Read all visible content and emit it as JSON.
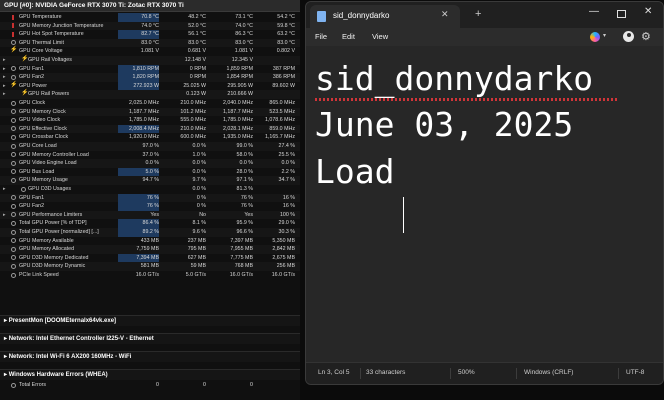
{
  "hwinfo": {
    "gpu_group": "GPU [#0]: NVIDIA GeForce RTX 3070 Ti: Zotac RTX 3070 Ti",
    "rows": [
      {
        "label": "GPU Temperature",
        "icon": "temperature-icon",
        "v": [
          "70.8 °C",
          "48.2 °C",
          "73.1 °C",
          "54.2 °C"
        ],
        "hl": true
      },
      {
        "label": "GPU Memory Junction Temperature",
        "icon": "temperature-icon",
        "v": [
          "74.0 °C",
          "52.0 °C",
          "74.0 °C",
          "59.8 °C"
        ]
      },
      {
        "label": "GPU Hot Spot Temperature",
        "icon": "temperature-icon",
        "v": [
          "82.7 °C",
          "56.1 °C",
          "86.3 °C",
          "63.2 °C"
        ],
        "hl": true
      },
      {
        "label": "GPU Thermal Limit",
        "icon": "gauge-icon",
        "v": [
          "83.0 °C",
          "83.0 °C",
          "83.0 °C",
          "83.0 °C"
        ]
      },
      {
        "label": "GPU Core Voltage",
        "icon": "bolt-icon",
        "v": [
          "1.081 V",
          "0.681 V",
          "1.081 V",
          "0.802 V"
        ]
      },
      {
        "label": "GPU Rail Voltages",
        "icon": "bolt-icon",
        "v": [
          "",
          "12.148 V",
          "12.345 V",
          ""
        ],
        "expand": true
      },
      {
        "label": "GPU Fan1",
        "icon": "fan-icon",
        "v": [
          "1,810 RPM",
          "0 RPM",
          "1,859 RPM",
          "387 RPM"
        ],
        "hl": true,
        "expand": true
      },
      {
        "label": "GPU Fan2",
        "icon": "fan-icon",
        "v": [
          "1,820 RPM",
          "0 RPM",
          "1,854 RPM",
          "386 RPM"
        ],
        "hl": true,
        "expand": true
      },
      {
        "label": "GPU Power",
        "icon": "bolt-icon",
        "v": [
          "272.923 W",
          "25.025 W",
          "295.905 W",
          "89.602 W"
        ],
        "hl": true,
        "expand": true
      },
      {
        "label": "GPU Rail Powers",
        "icon": "bolt-icon",
        "v": [
          "",
          "0.123 W",
          "210.666 W",
          ""
        ],
        "expand": true
      },
      {
        "label": "GPU Clock",
        "icon": "clock-icon",
        "v": [
          "2,025.0 MHz",
          "210.0 MHz",
          "2,040.0 MHz",
          "865.0 MHz"
        ]
      },
      {
        "label": "GPU Memory Clock",
        "icon": "clock-icon",
        "v": [
          "1,187.7 MHz",
          "101.2 MHz",
          "1,187.7 MHz",
          "523.5 MHz"
        ]
      },
      {
        "label": "GPU Video Clock",
        "icon": "clock-icon",
        "v": [
          "1,785.0 MHz",
          "555.0 MHz",
          "1,785.0 MHz",
          "1,078.6 MHz"
        ]
      },
      {
        "label": "GPU Effective Clock",
        "icon": "clock-icon",
        "v": [
          "2,008.4 MHz",
          "210.0 MHz",
          "2,028.1 MHz",
          "859.0 MHz"
        ],
        "hl": true
      },
      {
        "label": "GPU Crossbar Clock",
        "icon": "clock-icon",
        "v": [
          "1,920.0 MHz",
          "600.0 MHz",
          "1,935.0 MHz",
          "1,165.7 MHz"
        ]
      },
      {
        "label": "GPU Core Load",
        "icon": "load-icon",
        "v": [
          "97.0 %",
          "0.0 %",
          "99.0 %",
          "27.4 %"
        ]
      },
      {
        "label": "GPU Memory Controller Load",
        "icon": "load-icon",
        "v": [
          "37.0 %",
          "1.0 %",
          "58.0 %",
          "25.5 %"
        ]
      },
      {
        "label": "GPU Video Engine Load",
        "icon": "load-icon",
        "v": [
          "0.0 %",
          "0.0 %",
          "0.0 %",
          "0.0 %"
        ]
      },
      {
        "label": "GPU Bus Load",
        "icon": "load-icon",
        "v": [
          "5.0 %",
          "0.0 %",
          "28.0 %",
          "2.2 %"
        ],
        "hl": true
      },
      {
        "label": "GPU Memory Usage",
        "icon": "load-icon",
        "v": [
          "94.7 %",
          "9.7 %",
          "97.1 %",
          "34.7 %"
        ]
      },
      {
        "label": "GPU D3D Usages",
        "icon": "load-icon",
        "v": [
          "",
          "0.0 %",
          "81.3 %",
          ""
        ],
        "expand": true
      },
      {
        "label": "GPU Fan1",
        "icon": "fan-icon",
        "v": [
          "76 %",
          "0 %",
          "76 %",
          "16 %"
        ],
        "hl": true
      },
      {
        "label": "GPU Fan2",
        "icon": "fan-icon",
        "v": [
          "76 %",
          "0 %",
          "76 %",
          "16 %"
        ],
        "hl": true
      },
      {
        "label": "GPU Performance Limiters",
        "icon": "gauge-icon",
        "v": [
          "Yes",
          "No",
          "Yes",
          "100 %"
        ],
        "expand": true
      },
      {
        "label": "Total GPU Power [% of TDP]",
        "icon": "gauge-icon",
        "v": [
          "86.4 %",
          "8.1 %",
          "95.9 %",
          "29.0 %"
        ],
        "hl": true
      },
      {
        "label": "Total GPU Power [normalized] [...]",
        "icon": "gauge-icon",
        "v": [
          "89.2 %",
          "9.6 %",
          "96.6 %",
          "30.3 %"
        ],
        "hl": true
      },
      {
        "label": "GPU Memory Available",
        "icon": "memory-icon",
        "v": [
          "433 MB",
          "237 MB",
          "7,397 MB",
          "5,350 MB"
        ]
      },
      {
        "label": "GPU Memory Allocated",
        "icon": "memory-icon",
        "v": [
          "7,759 MB",
          "795 MB",
          "7,955 MB",
          "2,842 MB"
        ]
      },
      {
        "label": "GPU D3D Memory Dedicated",
        "icon": "memory-icon",
        "v": [
          "7,394 MB",
          "627 MB",
          "7,775 MB",
          "2,675 MB"
        ],
        "hl": true
      },
      {
        "label": "GPU D3D Memory Dynamic",
        "icon": "memory-icon",
        "v": [
          "581 MB",
          "59 MB",
          "768 MB",
          "256 MB"
        ]
      },
      {
        "label": "PCIe Link Speed",
        "icon": "link-icon",
        "v": [
          "16.0 GT/s",
          "5.0 GT/s",
          "16.0 GT/s",
          "16.0 GT/s"
        ]
      }
    ],
    "groups": [
      "PresentMon [DOOMEternalx64vk.exe]",
      "Network: Intel Ethernet Controller I225-V - Ethernet",
      "Network: Intel Wi-Fi 6 AX200 160MHz - WiFi",
      "Windows Hardware Errors (WHEA)"
    ],
    "last_row": {
      "label": "Total Errors",
      "v": [
        "0",
        "0",
        "0",
        ""
      ]
    }
  },
  "notepad": {
    "tab_title": "sid_donnydarko",
    "menu": {
      "file": "File",
      "edit": "Edit",
      "view": "View"
    },
    "lines": [
      "sid_donnydarko",
      "June 03, 2025",
      "Load"
    ],
    "status": {
      "position": "Ln 3, Col 5",
      "characters": "33 characters",
      "zoom": "500%",
      "line_endings": "Windows (CRLF)",
      "encoding": "UTF-8"
    },
    "colors": {
      "accent": "#1e3a5f",
      "spellcheck": "#d13438"
    }
  }
}
